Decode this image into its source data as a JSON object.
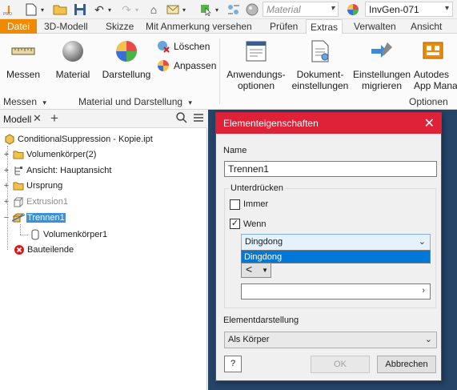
{
  "qat": {
    "material_placeholder": "Material",
    "appearance_value": "InvGen-071"
  },
  "tabs": [
    {
      "label": "Datei"
    },
    {
      "label": "3D-Modell"
    },
    {
      "label": "Skizze"
    },
    {
      "label": "Mit Anmerkung versehen"
    },
    {
      "label": "Prüfen"
    },
    {
      "label": "Extras"
    },
    {
      "label": "Verwalten"
    },
    {
      "label": "Ansicht"
    }
  ],
  "ribbon": {
    "messen": "Messen",
    "material": "Material",
    "darstellung": "Darstellung",
    "loeschen": "Löschen",
    "anpassen": "Anpassen",
    "anwendungsoptionen_1": "Anwendungs-",
    "anwendungsoptionen_2": "optionen",
    "dokument_1": "Dokument-",
    "dokument_2": "einstellungen",
    "einstellungen_1": "Einstellungen",
    "einstellungen_2": "migrieren",
    "autodesk_1": "Autodes",
    "autodesk_2": "App Mana",
    "group_messen": "Messen",
    "group_material": "Material und Darstellung",
    "group_optionen": "Optionen"
  },
  "browser": {
    "title": "Modell",
    "items": [
      {
        "label": "ConditionalSuppression - Kopie.ipt"
      },
      {
        "label": "Volumenkörper(2)"
      },
      {
        "label": "Ansicht: Hauptansicht"
      },
      {
        "label": "Ursprung"
      },
      {
        "label": "Extrusion1"
      },
      {
        "label": "Trennen1"
      },
      {
        "label": "Volumenkörper1"
      },
      {
        "label": "Bauteilende"
      }
    ]
  },
  "dialog": {
    "title": "Elementeigenschaften",
    "name_label": "Name",
    "name_value": "Trennen1",
    "unterdruecken_label": "Unterdrücken",
    "immer_label": "Immer",
    "wenn_label": "Wenn",
    "condition_value": "Dingdong",
    "dropdown_option": "Dingdong",
    "operator_value": "<",
    "elementdarstellung_label": "Elementdarstellung",
    "darstellung_value": "Als Körper",
    "help_label": "?",
    "ok_label": "OK",
    "cancel_label": "Abbrechen",
    "immer_checked": false,
    "wenn_checked": true
  }
}
